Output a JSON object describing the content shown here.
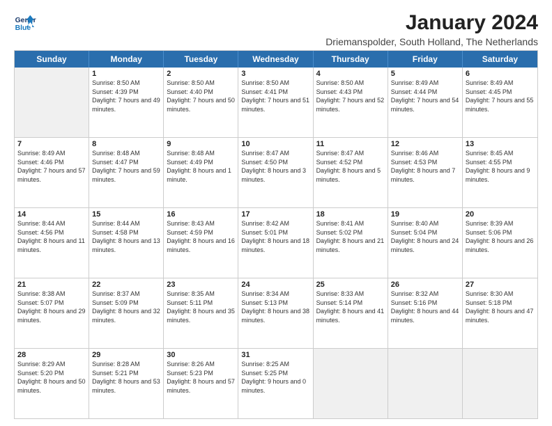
{
  "logo": {
    "line1": "General",
    "line2": "Blue"
  },
  "title": "January 2024",
  "subtitle": "Driemanspolder, South Holland, The Netherlands",
  "header_days": [
    "Sunday",
    "Monday",
    "Tuesday",
    "Wednesday",
    "Thursday",
    "Friday",
    "Saturday"
  ],
  "weeks": [
    [
      {
        "day": "",
        "sunrise": "",
        "sunset": "",
        "daylight": "",
        "shaded": true
      },
      {
        "day": "1",
        "sunrise": "8:50 AM",
        "sunset": "4:39 PM",
        "daylight": "7 hours and 49 minutes."
      },
      {
        "day": "2",
        "sunrise": "8:50 AM",
        "sunset": "4:40 PM",
        "daylight": "7 hours and 50 minutes."
      },
      {
        "day": "3",
        "sunrise": "8:50 AM",
        "sunset": "4:41 PM",
        "daylight": "7 hours and 51 minutes."
      },
      {
        "day": "4",
        "sunrise": "8:50 AM",
        "sunset": "4:43 PM",
        "daylight": "7 hours and 52 minutes."
      },
      {
        "day": "5",
        "sunrise": "8:49 AM",
        "sunset": "4:44 PM",
        "daylight": "7 hours and 54 minutes."
      },
      {
        "day": "6",
        "sunrise": "8:49 AM",
        "sunset": "4:45 PM",
        "daylight": "7 hours and 55 minutes."
      }
    ],
    [
      {
        "day": "7",
        "sunrise": "8:49 AM",
        "sunset": "4:46 PM",
        "daylight": "7 hours and 57 minutes."
      },
      {
        "day": "8",
        "sunrise": "8:48 AM",
        "sunset": "4:47 PM",
        "daylight": "7 hours and 59 minutes."
      },
      {
        "day": "9",
        "sunrise": "8:48 AM",
        "sunset": "4:49 PM",
        "daylight": "8 hours and 1 minute."
      },
      {
        "day": "10",
        "sunrise": "8:47 AM",
        "sunset": "4:50 PM",
        "daylight": "8 hours and 3 minutes."
      },
      {
        "day": "11",
        "sunrise": "8:47 AM",
        "sunset": "4:52 PM",
        "daylight": "8 hours and 5 minutes."
      },
      {
        "day": "12",
        "sunrise": "8:46 AM",
        "sunset": "4:53 PM",
        "daylight": "8 hours and 7 minutes."
      },
      {
        "day": "13",
        "sunrise": "8:45 AM",
        "sunset": "4:55 PM",
        "daylight": "8 hours and 9 minutes."
      }
    ],
    [
      {
        "day": "14",
        "sunrise": "8:44 AM",
        "sunset": "4:56 PM",
        "daylight": "8 hours and 11 minutes."
      },
      {
        "day": "15",
        "sunrise": "8:44 AM",
        "sunset": "4:58 PM",
        "daylight": "8 hours and 13 minutes."
      },
      {
        "day": "16",
        "sunrise": "8:43 AM",
        "sunset": "4:59 PM",
        "daylight": "8 hours and 16 minutes."
      },
      {
        "day": "17",
        "sunrise": "8:42 AM",
        "sunset": "5:01 PM",
        "daylight": "8 hours and 18 minutes."
      },
      {
        "day": "18",
        "sunrise": "8:41 AM",
        "sunset": "5:02 PM",
        "daylight": "8 hours and 21 minutes."
      },
      {
        "day": "19",
        "sunrise": "8:40 AM",
        "sunset": "5:04 PM",
        "daylight": "8 hours and 24 minutes."
      },
      {
        "day": "20",
        "sunrise": "8:39 AM",
        "sunset": "5:06 PM",
        "daylight": "8 hours and 26 minutes."
      }
    ],
    [
      {
        "day": "21",
        "sunrise": "8:38 AM",
        "sunset": "5:07 PM",
        "daylight": "8 hours and 29 minutes."
      },
      {
        "day": "22",
        "sunrise": "8:37 AM",
        "sunset": "5:09 PM",
        "daylight": "8 hours and 32 minutes."
      },
      {
        "day": "23",
        "sunrise": "8:35 AM",
        "sunset": "5:11 PM",
        "daylight": "8 hours and 35 minutes."
      },
      {
        "day": "24",
        "sunrise": "8:34 AM",
        "sunset": "5:13 PM",
        "daylight": "8 hours and 38 minutes."
      },
      {
        "day": "25",
        "sunrise": "8:33 AM",
        "sunset": "5:14 PM",
        "daylight": "8 hours and 41 minutes."
      },
      {
        "day": "26",
        "sunrise": "8:32 AM",
        "sunset": "5:16 PM",
        "daylight": "8 hours and 44 minutes."
      },
      {
        "day": "27",
        "sunrise": "8:30 AM",
        "sunset": "5:18 PM",
        "daylight": "8 hours and 47 minutes."
      }
    ],
    [
      {
        "day": "28",
        "sunrise": "8:29 AM",
        "sunset": "5:20 PM",
        "daylight": "8 hours and 50 minutes."
      },
      {
        "day": "29",
        "sunrise": "8:28 AM",
        "sunset": "5:21 PM",
        "daylight": "8 hours and 53 minutes."
      },
      {
        "day": "30",
        "sunrise": "8:26 AM",
        "sunset": "5:23 PM",
        "daylight": "8 hours and 57 minutes."
      },
      {
        "day": "31",
        "sunrise": "8:25 AM",
        "sunset": "5:25 PM",
        "daylight": "9 hours and 0 minutes."
      },
      {
        "day": "",
        "sunrise": "",
        "sunset": "",
        "daylight": "",
        "shaded": true
      },
      {
        "day": "",
        "sunrise": "",
        "sunset": "",
        "daylight": "",
        "shaded": true
      },
      {
        "day": "",
        "sunrise": "",
        "sunset": "",
        "daylight": "",
        "shaded": true
      }
    ]
  ]
}
